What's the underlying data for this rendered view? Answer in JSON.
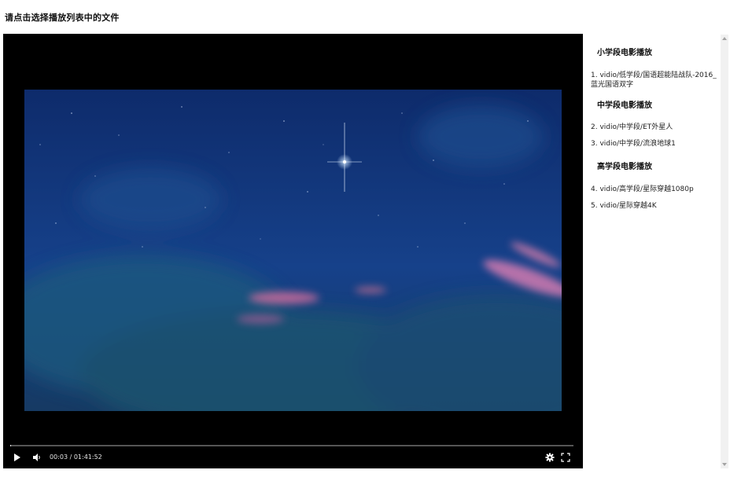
{
  "page": {
    "title": "请点击选择播放列表中的文件"
  },
  "player": {
    "time_display": "00:03 / 01:41:52",
    "progress_percent": 0.05,
    "icons": {
      "play": "play-icon",
      "volume": "volume-icon",
      "settings": "gear-icon",
      "fullscreen": "fullscreen-icon"
    },
    "colors": {
      "background": "#000000",
      "sky_top": "#0f2f6e",
      "sky_bottom": "#15355f"
    }
  },
  "playlist": {
    "groups": [
      {
        "title": "小学段电影播放",
        "items": [
          {
            "number": "1.",
            "path": "vidio/低学段/国语超能陆战队-2016_蓝光国语双字"
          }
        ]
      },
      {
        "title": "中学段电影播放",
        "items": [
          {
            "number": "2.",
            "path": "vidio/中学段/ET外星人"
          },
          {
            "number": "3.",
            "path": "vidio/中学段/流浪地球1"
          }
        ]
      },
      {
        "title": "高学段电影播放",
        "items": [
          {
            "number": "4.",
            "path": "vidio/高学段/星际穿越1080p"
          },
          {
            "number": "5.",
            "path": "vidio/星际穿越4K"
          }
        ]
      }
    ]
  }
}
